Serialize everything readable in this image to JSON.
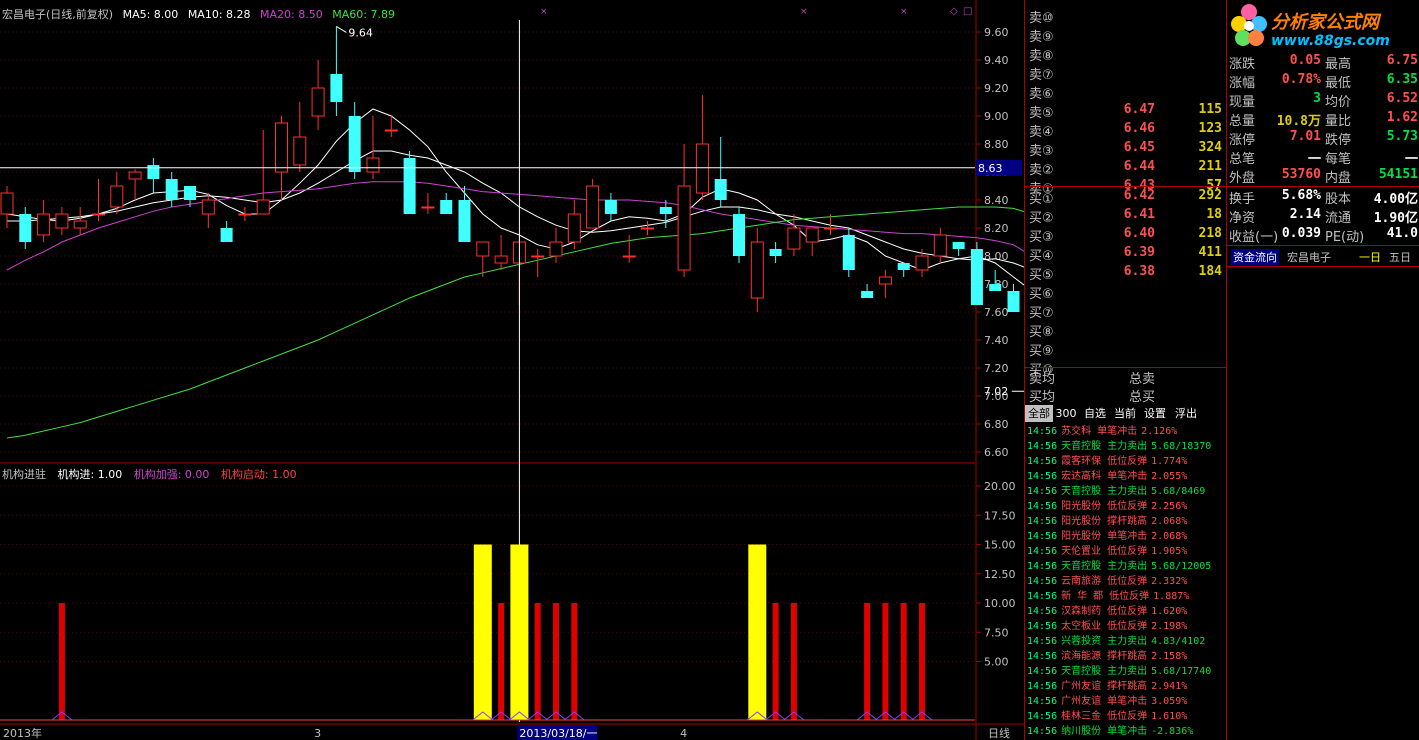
{
  "header": {
    "title": "宏昌电子(日线,前复权)",
    "ma5": "MA5: 8.00",
    "ma10": "MA10: 8.28",
    "ma20": "MA20: 8.50",
    "ma60": "MA60: 7.89"
  },
  "sub_header": {
    "name": "机构进驻",
    "inst_in": "机构进: 1.00",
    "inst_add": "机构加强: 0.00",
    "inst_start": "机构启动: 1.00"
  },
  "chart_data": {
    "type": "candlestick",
    "price_axis": {
      "ticks": [
        "9.60",
        "9.40",
        "9.20",
        "9.00",
        "8.80",
        "8.60",
        "8.40",
        "8.20",
        "8.00",
        "7.80",
        "7.60",
        "7.40",
        "7.20",
        "7.00",
        "6.80",
        "6.60"
      ],
      "min": 6.6,
      "max": 9.6
    },
    "high_label": "9.64",
    "low_label": "7.02",
    "cross_price": "8.63",
    "candles": [
      [
        8.3,
        8.45,
        8.5,
        8.2
      ],
      [
        8.3,
        8.1,
        8.35,
        8.05
      ],
      [
        8.15,
        8.3,
        8.4,
        8.1
      ],
      [
        8.2,
        8.3,
        8.35,
        8.15
      ],
      [
        8.2,
        8.25,
        8.35,
        8.15
      ],
      [
        8.3,
        8.3,
        8.55,
        8.25
      ],
      [
        8.35,
        8.5,
        8.6,
        8.3
      ],
      [
        8.55,
        8.6,
        8.62,
        8.4
      ],
      [
        8.65,
        8.55,
        8.7,
        8.45
      ],
      [
        8.55,
        8.4,
        8.6,
        8.35
      ],
      [
        8.5,
        8.4,
        8.5,
        8.35
      ],
      [
        8.3,
        8.4,
        8.45,
        8.2
      ],
      [
        8.2,
        8.1,
        8.25,
        8.1
      ],
      [
        8.3,
        8.3,
        8.35,
        8.25
      ],
      [
        8.3,
        8.4,
        8.9,
        8.3
      ],
      [
        8.6,
        8.95,
        9.0,
        8.4
      ],
      [
        8.65,
        8.85,
        9.1,
        8.6
      ],
      [
        9.0,
        9.2,
        9.4,
        8.9
      ],
      [
        9.3,
        9.1,
        9.64,
        9.0
      ],
      [
        9.0,
        8.6,
        9.1,
        8.55
      ],
      [
        8.6,
        8.7,
        9.0,
        8.55
      ],
      [
        8.9,
        8.9,
        9.0,
        8.85
      ],
      [
        8.7,
        8.3,
        8.75,
        8.3
      ],
      [
        8.35,
        8.35,
        8.45,
        8.3
      ],
      [
        8.4,
        8.3,
        8.45,
        8.3
      ],
      [
        8.4,
        8.1,
        8.5,
        8.1
      ],
      [
        8.0,
        8.1,
        8.1,
        7.85
      ],
      [
        7.95,
        8.0,
        8.15,
        7.9
      ],
      [
        7.95,
        8.1,
        8.15,
        7.65
      ],
      [
        8.0,
        8.0,
        8.05,
        7.85
      ],
      [
        8.0,
        8.1,
        8.2,
        7.95
      ],
      [
        8.1,
        8.3,
        8.4,
        8.05
      ],
      [
        8.2,
        8.5,
        8.55,
        8.2
      ],
      [
        8.4,
        8.3,
        8.45,
        8.25
      ],
      [
        8.0,
        8.0,
        8.15,
        7.95
      ],
      [
        8.2,
        8.2,
        8.25,
        8.15
      ],
      [
        8.35,
        8.3,
        8.4,
        8.2
      ],
      [
        7.9,
        8.5,
        8.8,
        7.85
      ],
      [
        8.45,
        8.8,
        9.15,
        8.4
      ],
      [
        8.55,
        8.4,
        8.85,
        8.35
      ],
      [
        8.3,
        8.0,
        8.35,
        7.95
      ],
      [
        7.7,
        8.1,
        8.2,
        7.6
      ],
      [
        8.05,
        8.0,
        8.1,
        7.95
      ],
      [
        8.05,
        8.2,
        8.3,
        8.0
      ],
      [
        8.1,
        8.2,
        8.2,
        8.0
      ],
      [
        8.2,
        8.2,
        8.3,
        8.15
      ],
      [
        8.15,
        7.9,
        8.2,
        7.85
      ],
      [
        7.75,
        7.7,
        7.8,
        7.7
      ],
      [
        7.8,
        7.85,
        7.9,
        7.7
      ],
      [
        7.95,
        7.9,
        7.95,
        7.85
      ],
      [
        7.9,
        8.0,
        8.05,
        7.85
      ],
      [
        8.0,
        8.15,
        8.2,
        7.95
      ],
      [
        8.1,
        8.05,
        8.1,
        8.0
      ],
      [
        8.05,
        7.65,
        8.1,
        7.65
      ],
      [
        7.8,
        7.75,
        7.9,
        7.75
      ],
      [
        7.75,
        7.6,
        7.8,
        7.6
      ],
      [
        7.6,
        7.02,
        7.65,
        7.02
      ]
    ],
    "ma": [
      {
        "name": "MA5",
        "color": "#ffffff",
        "values": [
          8.3,
          8.28,
          8.26,
          8.25,
          8.27,
          8.3,
          8.34,
          8.4,
          8.45,
          8.46,
          8.47,
          8.44,
          8.36,
          8.3,
          8.3,
          8.4,
          8.52,
          8.65,
          8.82,
          8.95,
          9.05,
          9.0,
          8.9,
          8.78,
          8.6,
          8.45,
          8.3,
          8.2,
          8.15,
          8.08,
          8.05,
          8.1,
          8.18,
          8.25,
          8.28,
          8.27,
          8.25,
          8.3,
          8.42,
          8.48,
          8.45,
          8.4,
          8.3,
          8.22,
          8.1,
          8.12,
          8.15,
          8.1,
          8.0,
          7.95,
          7.9,
          7.95,
          7.98,
          8.0,
          7.95,
          7.85,
          7.75
        ]
      },
      {
        "name": "MA10",
        "color": "#ffffff",
        "values": [
          8.25,
          8.25,
          8.26,
          8.27,
          8.28,
          8.3,
          8.32,
          8.35,
          8.38,
          8.4,
          8.42,
          8.43,
          8.42,
          8.4,
          8.38,
          8.4,
          8.45,
          8.52,
          8.6,
          8.68,
          8.75,
          8.75,
          8.72,
          8.7,
          8.65,
          8.6,
          8.52,
          8.45,
          8.35,
          8.28,
          8.22,
          8.18,
          8.17,
          8.18,
          8.2,
          8.22,
          8.24,
          8.28,
          8.32,
          8.35,
          8.35,
          8.33,
          8.3,
          8.28,
          8.25,
          8.22,
          8.2,
          8.15,
          8.1,
          8.05,
          8.02,
          8.0,
          7.98,
          7.97,
          7.98,
          7.95,
          7.9
        ]
      },
      {
        "name": "MA20",
        "color": "#d040d0",
        "values": [
          7.9,
          7.97,
          8.03,
          8.1,
          8.15,
          8.2,
          8.24,
          8.28,
          8.32,
          8.35,
          8.37,
          8.39,
          8.41,
          8.43,
          8.45,
          8.46,
          8.47,
          8.48,
          8.5,
          8.52,
          8.53,
          8.53,
          8.53,
          8.52,
          8.5,
          8.48,
          8.46,
          8.45,
          8.44,
          8.43,
          8.42,
          8.41,
          8.4,
          8.4,
          8.4,
          8.39,
          8.38,
          8.36,
          8.33,
          8.3,
          8.28,
          8.26,
          8.24,
          8.22,
          8.21,
          8.2,
          8.19,
          8.18,
          8.17,
          8.16,
          8.16,
          8.15,
          8.14,
          8.13,
          8.11,
          8.08,
          8.0
        ]
      },
      {
        "name": "MA60",
        "color": "#40e040",
        "values": [
          6.7,
          6.72,
          6.75,
          6.78,
          6.81,
          6.85,
          6.89,
          6.93,
          6.97,
          7.01,
          7.05,
          7.1,
          7.15,
          7.2,
          7.25,
          7.3,
          7.35,
          7.4,
          7.46,
          7.52,
          7.58,
          7.64,
          7.7,
          7.75,
          7.8,
          7.85,
          7.88,
          7.91,
          7.94,
          7.97,
          8.0,
          8.03,
          8.06,
          8.09,
          8.11,
          8.13,
          8.14,
          8.15,
          8.16,
          8.18,
          8.2,
          8.22,
          8.24,
          8.26,
          8.27,
          8.28,
          8.29,
          8.3,
          8.31,
          8.32,
          8.33,
          8.34,
          8.35,
          8.35,
          8.35,
          8.34,
          8.3
        ]
      }
    ],
    "indicator": {
      "axis_ticks": [
        "20.00",
        "17.50",
        "15.00",
        "12.50",
        "10.00",
        "7.50",
        "5.00"
      ],
      "min": 0,
      "max": 20,
      "bars": [
        {
          "i": 3,
          "v": 10,
          "c": "red"
        },
        {
          "i": 26,
          "v": 15,
          "c": "yellow"
        },
        {
          "i": 27,
          "v": 10,
          "c": "red"
        },
        {
          "i": 28,
          "v": 15,
          "c": "yellow"
        },
        {
          "i": 29,
          "v": 10,
          "c": "red"
        },
        {
          "i": 30,
          "v": 10,
          "c": "red"
        },
        {
          "i": 31,
          "v": 10,
          "c": "red"
        },
        {
          "i": 41,
          "v": 15,
          "c": "yellow"
        },
        {
          "i": 42,
          "v": 10,
          "c": "red"
        },
        {
          "i": 43,
          "v": 10,
          "c": "red"
        },
        {
          "i": 47,
          "v": 10,
          "c": "red"
        },
        {
          "i": 48,
          "v": 10,
          "c": "red"
        },
        {
          "i": 49,
          "v": 10,
          "c": "red"
        },
        {
          "i": 50,
          "v": 10,
          "c": "red"
        }
      ]
    },
    "x_labels": [
      {
        "i": 0,
        "text": "2013年"
      },
      {
        "i": 17,
        "text": "3"
      },
      {
        "i": 37,
        "text": "4"
      }
    ],
    "cursor_label": "2013/03/18/一",
    "period_label": "日线"
  },
  "orderbook": {
    "sells": [
      {
        "label": "卖⑩",
        "price": "",
        "vol": ""
      },
      {
        "label": "卖⑨",
        "price": "",
        "vol": ""
      },
      {
        "label": "卖⑧",
        "price": "",
        "vol": ""
      },
      {
        "label": "卖⑦",
        "price": "",
        "vol": ""
      },
      {
        "label": "卖⑥",
        "price": "",
        "vol": ""
      },
      {
        "label": "卖⑤",
        "price": "6.47",
        "vol": "115"
      },
      {
        "label": "卖④",
        "price": "6.46",
        "vol": "123"
      },
      {
        "label": "卖③",
        "price": "6.45",
        "vol": "324"
      },
      {
        "label": "卖②",
        "price": "6.44",
        "vol": "211"
      },
      {
        "label": "卖①",
        "price": "6.43",
        "vol": "57"
      }
    ],
    "buys": [
      {
        "label": "买①",
        "price": "6.42",
        "vol": "292"
      },
      {
        "label": "买②",
        "price": "6.41",
        "vol": "18"
      },
      {
        "label": "买③",
        "price": "6.40",
        "vol": "218"
      },
      {
        "label": "买④",
        "price": "6.39",
        "vol": "411"
      },
      {
        "label": "买⑤",
        "price": "6.38",
        "vol": "184"
      },
      {
        "label": "买⑥",
        "price": "",
        "vol": ""
      },
      {
        "label": "买⑦",
        "price": "",
        "vol": ""
      },
      {
        "label": "买⑧",
        "price": "",
        "vol": ""
      },
      {
        "label": "买⑨",
        "price": "",
        "vol": ""
      },
      {
        "label": "买⑩",
        "price": "",
        "vol": ""
      }
    ],
    "sell_avg": "卖均",
    "buy_avg": "买均",
    "total_sell": "总卖",
    "total_buy": "总买"
  },
  "tabs": [
    "全部",
    "300",
    "自选",
    "当前",
    "设置",
    "浮出"
  ],
  "feed": [
    {
      "t": "14:56",
      "n": "苏交科",
      "k": "单笔冲击",
      "r": "2.126%",
      "c": "red"
    },
    {
      "t": "14:56",
      "n": "天音控股",
      "k": "主力卖出",
      "r": "5.68/18370",
      "c": "green"
    },
    {
      "t": "14:56",
      "n": "霞客环保",
      "k": "低位反弹",
      "r": "1.774%",
      "c": "red"
    },
    {
      "t": "14:56",
      "n": "宏达高科",
      "k": "单笔冲击",
      "r": "2.055%",
      "c": "red"
    },
    {
      "t": "14:56",
      "n": "天音控股",
      "k": "主力卖出",
      "r": "5.68/8469",
      "c": "green"
    },
    {
      "t": "14:56",
      "n": "阳光股份",
      "k": "低位反弹",
      "r": "2.256%",
      "c": "red"
    },
    {
      "t": "14:56",
      "n": "阳光股份",
      "k": "撑杆跳高",
      "r": "2.068%",
      "c": "red"
    },
    {
      "t": "14:56",
      "n": "阳光股份",
      "k": "单笔冲击",
      "r": "2.068%",
      "c": "red"
    },
    {
      "t": "14:56",
      "n": "天伦置业",
      "k": "低位反弹",
      "r": "1.905%",
      "c": "red"
    },
    {
      "t": "14:56",
      "n": "天音控股",
      "k": "主力卖出",
      "r": "5.68/12005",
      "c": "green"
    },
    {
      "t": "14:56",
      "n": "云南旅游",
      "k": "低位反弹",
      "r": "2.332%",
      "c": "red"
    },
    {
      "t": "14:56",
      "n": "新 华 都",
      "k": "低位反弹",
      "r": "1.887%",
      "c": "red"
    },
    {
      "t": "14:56",
      "n": "汉森制药",
      "k": "低位反弹",
      "r": "1.620%",
      "c": "red"
    },
    {
      "t": "14:56",
      "n": "太空板业",
      "k": "低位反弹",
      "r": "2.198%",
      "c": "red"
    },
    {
      "t": "14:56",
      "n": "兴蓉投资",
      "k": "主力卖出",
      "r": "4.83/4102",
      "c": "green"
    },
    {
      "t": "14:56",
      "n": "滨海能源",
      "k": "撑杆跳高",
      "r": "2.158%",
      "c": "red"
    },
    {
      "t": "14:56",
      "n": "天音控股",
      "k": "主力卖出",
      "r": "5.68/17740",
      "c": "green"
    },
    {
      "t": "14:56",
      "n": "广州友谊",
      "k": "撑杆跳高",
      "r": "2.941%",
      "c": "red"
    },
    {
      "t": "14:56",
      "n": "广州友谊",
      "k": "单笔冲击",
      "r": "3.059%",
      "c": "red"
    },
    {
      "t": "14:56",
      "n": "桂林三金",
      "k": "低位反弹",
      "r": "1.610%",
      "c": "red"
    },
    {
      "t": "14:56",
      "n": "纳川股份",
      "k": "单笔冲击",
      "r": "-2.836%",
      "c": "green"
    }
  ],
  "logo": {
    "title": "分析家公式网",
    "url": "www.88gs.com"
  },
  "info": [
    {
      "l1": "涨跌",
      "v1": "0.05",
      "c1": "red",
      "l2": "最高",
      "v2": "6.75",
      "c2": "red"
    },
    {
      "l1": "涨幅",
      "v1": "0.78%",
      "c1": "red",
      "l2": "最低",
      "v2": "6.35",
      "c2": "green"
    },
    {
      "l1": "现量",
      "v1": "3",
      "c1": "green",
      "l2": "均价",
      "v2": "6.52",
      "c2": "red"
    },
    {
      "l1": "总量",
      "v1": "10.8万",
      "c1": "yellow",
      "l2": "量比",
      "v2": "1.62",
      "c2": "red"
    },
    {
      "l1": "涨停",
      "v1": "7.01",
      "c1": "red",
      "l2": "跌停",
      "v2": "5.73",
      "c2": "green"
    },
    {
      "l1": "总笔",
      "v1": "一",
      "c1": "white",
      "l2": "每笔",
      "v2": "一",
      "c2": "white"
    },
    {
      "l1": "外盘",
      "v1": "53760",
      "c1": "red",
      "l2": "内盘",
      "v2": "54151",
      "c2": "green"
    },
    {
      "l1": "换手",
      "v1": "5.68%",
      "c1": "white",
      "l2": "股本",
      "v2": "4.00亿",
      "c2": "white"
    },
    {
      "l1": "净资",
      "v1": "2.14",
      "c1": "white",
      "l2": "流通",
      "v2": "1.90亿",
      "c2": "white"
    },
    {
      "l1": "收益(一)",
      "v1": "0.039",
      "c1": "white",
      "l2": "PE(动)",
      "v2": "41.0",
      "c2": "white"
    }
  ],
  "flow": {
    "label": "资金流向",
    "stock": "宏昌电子",
    "one_day": "一日",
    "five_day": "五日"
  },
  "colors": {
    "up": "#ff3030",
    "down": "#40ffff",
    "red_bar": "#e00000",
    "yellow_bar": "#ffff00",
    "grid": "#a00000"
  }
}
